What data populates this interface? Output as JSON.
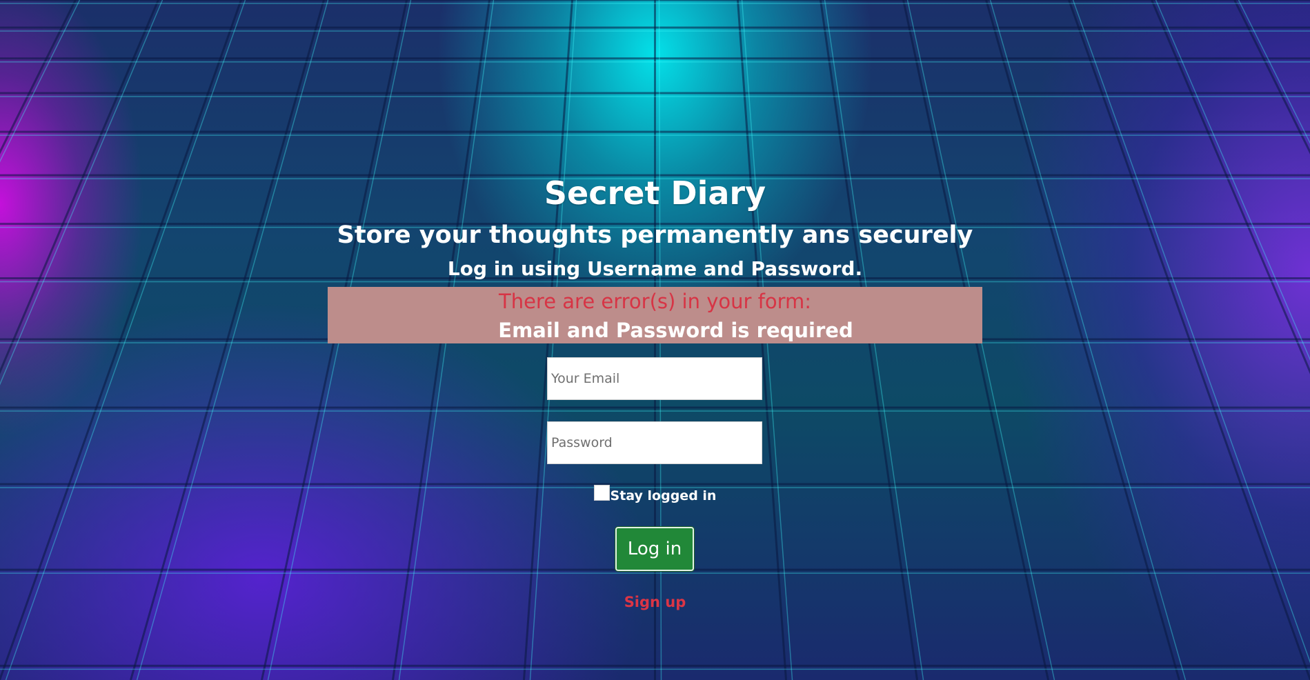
{
  "page": {
    "title": "Secret Diary",
    "subtitle": "Store your thoughts permanently ans securely",
    "instruction": "Log in using Username and Password."
  },
  "error": {
    "heading": "There are error(s) in your form:",
    "message": "Email and Password is required"
  },
  "form": {
    "email_placeholder": "Your Email",
    "password_placeholder": "Password",
    "stay_logged_in_label": "Stay logged in",
    "stay_logged_in_checked": false,
    "login_label": "Log in",
    "signup_label": "Sign up"
  },
  "colors": {
    "error_background": "#bd8d8b",
    "error_heading": "#d73445",
    "login_button": "#218838",
    "signup_link": "#dc3545"
  }
}
